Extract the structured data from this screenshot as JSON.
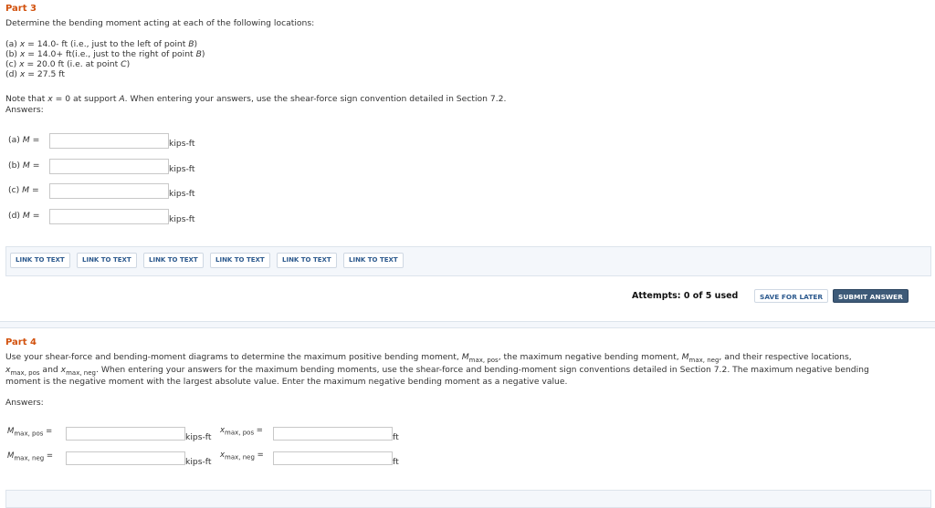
{
  "part3": {
    "title": "Part 3",
    "intro": "Determine the bending moment acting at each of the following locations:",
    "locations": [
      {
        "pre": "(a) ",
        "var": "x",
        "mid": " = 14.0- ft (i.e., just to the left of point ",
        "pt": "B",
        "post": ")"
      },
      {
        "pre": "(b) ",
        "var": "x",
        "mid": " = 14.0+ ft(i.e., just to the right of point ",
        "pt": "B",
        "post": ")"
      },
      {
        "pre": "(c) ",
        "var": "x",
        "mid": " = 20.0 ft (i.e. at point ",
        "pt": "C",
        "post": ")"
      },
      {
        "pre": "(d) ",
        "var": "x",
        "mid": " = 27.5 ft",
        "pt": "",
        "post": ""
      }
    ],
    "note_a": "Note that ",
    "note_var": "x",
    "note_b": " = 0 at support ",
    "note_pt": "A",
    "note_c": ". When entering your answers, use the shear-force sign convention detailed in Section 7.2.",
    "answers_label": "Answers:",
    "answers": [
      {
        "label": "(a) ",
        "var": "M",
        "eq": " =",
        "value": "",
        "unit": "kips-ft"
      },
      {
        "label": "(b) ",
        "var": "M",
        "eq": " =",
        "value": "",
        "unit": "kips-ft"
      },
      {
        "label": "(c) ",
        "var": "M",
        "eq": " =",
        "value": "",
        "unit": "kips-ft"
      },
      {
        "label": "(d) ",
        "var": "M",
        "eq": " =",
        "value": "",
        "unit": "kips-ft"
      }
    ],
    "links": [
      "LINK TO TEXT",
      "LINK TO TEXT",
      "LINK TO TEXT",
      "LINK TO TEXT",
      "LINK TO TEXT",
      "LINK TO TEXT"
    ],
    "attempts": "Attempts: 0 of 5 used",
    "save_label": "SAVE FOR LATER",
    "submit_label": "SUBMIT ANSWER"
  },
  "part4": {
    "title": "Part 4",
    "line1_a": "Use your shear-force and bending-moment diagrams to determine the maximum positive bending moment, ",
    "M": "M",
    "sub_maxpos": "max, pos",
    "sub_maxneg": "max, neg",
    "x": "x",
    "line1_b": ", the maximum negative bending moment, ",
    "line1_c": ", and their respective locations,",
    "line2_a": " and ",
    "line2_b": ". When entering your answers for the maximum bending moments, use the shear-force and bending-moment sign conventions detailed in Section 7.2. The maximum negative bending",
    "line3": "moment is the negative moment with the largest absolute value. Enter the maximum negative bending moment as a negative value.",
    "answers_label": "Answers:",
    "eq": " =",
    "unit_moment": "kips-ft",
    "unit_length": "ft",
    "values": {
      "m_pos": "",
      "x_pos": "",
      "m_neg": "",
      "x_neg": ""
    }
  }
}
